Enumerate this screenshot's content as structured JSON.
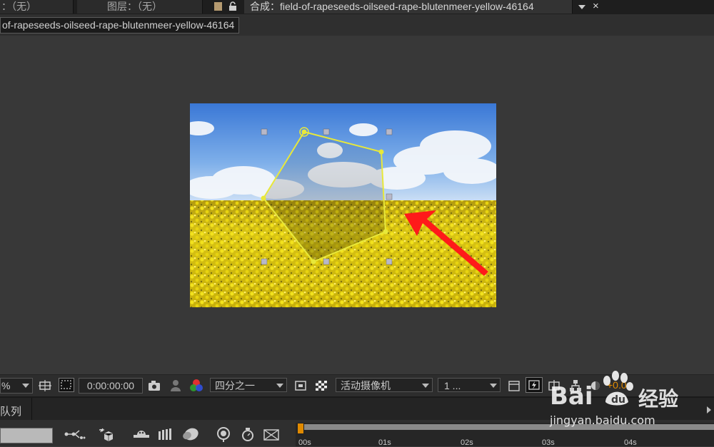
{
  "tabs": {
    "footage_tab": "：（无）",
    "layer_tab": "图层：（无）",
    "comp_tab_label": "合成",
    "comp_tab_name": "field-of-rapeseeds-oilseed-rape-blutenmeer-yellow-46164"
  },
  "breadcrumb": "of-rapeseeds-oilseed-rape-blutenmeer-yellow-46164",
  "toolbar": {
    "zoom_value": "%",
    "timecode": "0:00:00:00",
    "resolution": "四分之一",
    "camera": "活动摄像机",
    "views": "1 ...",
    "exposure": "+0.0"
  },
  "panel": {
    "label": "队列"
  },
  "timeline": {
    "ticks": [
      "00s",
      "01s",
      "02s",
      "03s",
      "04s"
    ]
  },
  "watermark": {
    "brand": "Bai",
    "brand2": "经验",
    "url": "jingyan.baidu.com"
  },
  "colors": {
    "mask_path": "#e8e83a",
    "arrow": "#ff1a1a",
    "accent_orange": "#e08a00"
  }
}
